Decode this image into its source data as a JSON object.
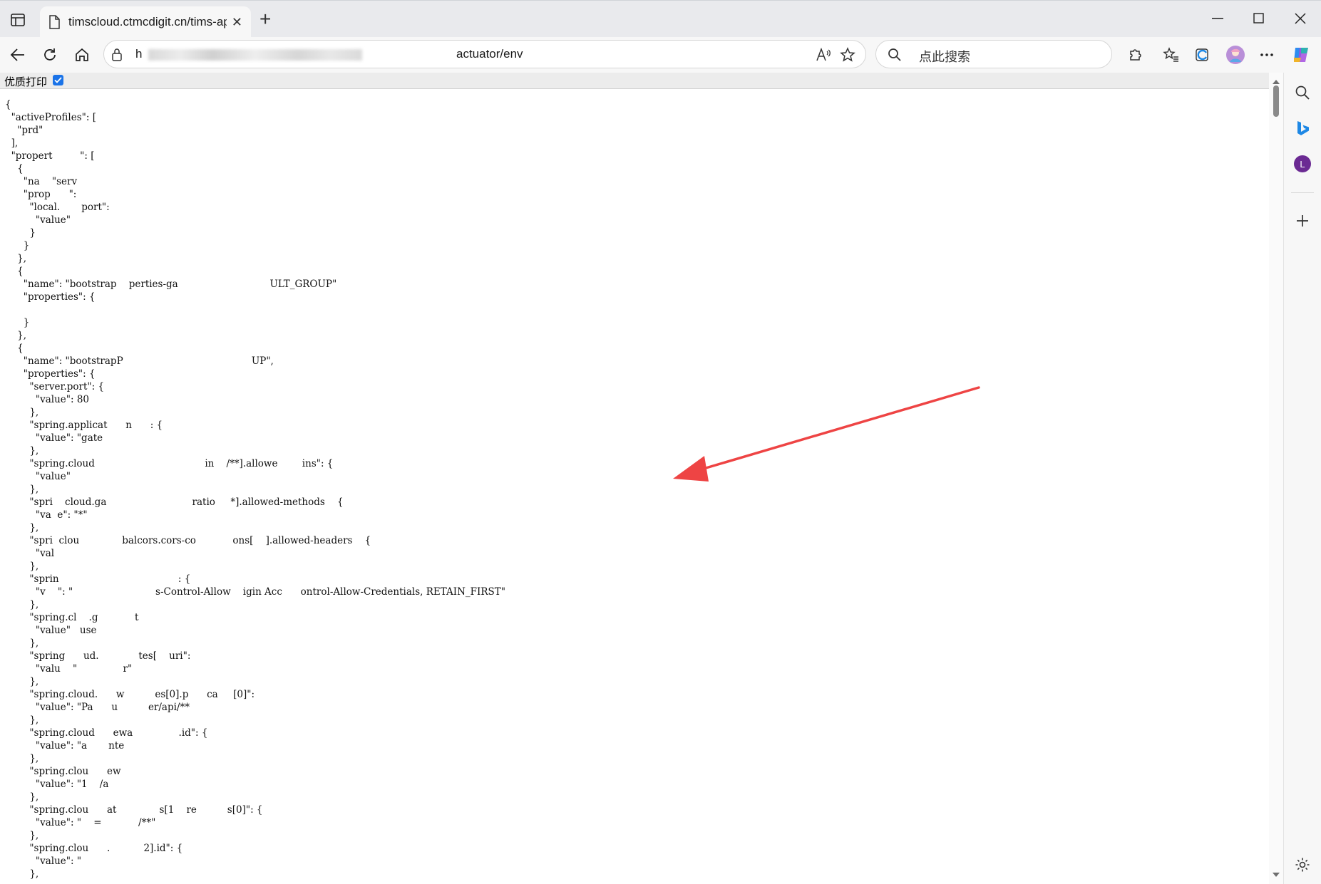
{
  "tab": {
    "title": "timscloud.ctmcdigit.cn/tims-api/a"
  },
  "address": {
    "prefix": "h",
    "visible_path": "actuator/env"
  },
  "search": {
    "placeholder": "点此搜索"
  },
  "print_option": {
    "label": "优质打印",
    "checked": true
  },
  "sidebar": {
    "avatar_letter": "L"
  },
  "json_lines": [
    "{",
    "  \"activeProfiles\": [",
    "    \"prd\"",
    "  ],",
    "  \"propert         \": [",
    "    {",
    "      \"na    \"serv",
    "      \"prop      \":",
    "        \"local.       port\":",
    "          \"value\"",
    "        }",
    "      }",
    "    },",
    "    {",
    "      \"name\": \"bootstrap    perties-ga                              ULT_GROUP\"",
    "      \"properties\": {",
    "",
    "      }",
    "    },",
    "    {",
    "      \"name\": \"bootstrapP                                          UP\",",
    "      \"properties\": {",
    "        \"server.port\": {",
    "          \"value\": 80",
    "        },",
    "        \"spring.applicat      n      : {",
    "          \"value\": \"gate",
    "        },",
    "        \"spring.cloud                                    in    /**].allowe        ins\": {",
    "          \"value\"",
    "        },",
    "        \"spri    cloud.ga                            ratio     *].allowed-methods    {",
    "          \"va  e\": \"*\"",
    "        },",
    "        \"spri  clou              balcors.cors-co            ons[    ].allowed-headers    {",
    "          \"val",
    "        },",
    "        \"sprin                                       : {",
    "          \"v    \": \"                           s-Control-Allow    igin Acc      ontrol-Allow-Credentials, RETAIN_FIRST\"",
    "        },",
    "        \"spring.cl    .g            t",
    "          \"value\"   use",
    "        },",
    "        \"spring      ud.             tes[    uri\":",
    "          \"valu    \"               r\"",
    "        },",
    "        \"spring.cloud.      w          es[0].p      ca     [0]\":",
    "          \"value\": \"Pa      u          er/api/**",
    "        },",
    "        \"spring.cloud      ewa               .id\": {",
    "          \"value\": \"a       nte",
    "        },",
    "        \"spring.clou      ew              ",
    "          \"value\": \"1    /a",
    "        },",
    "        \"spring.clou      at              s[1    re          s[0]\": {",
    "          \"value\": \"    =            /**\"",
    "        },",
    "        \"spring.clou      .           2].id\": {",
    "          \"value\": \"",
    "        },"
  ]
}
